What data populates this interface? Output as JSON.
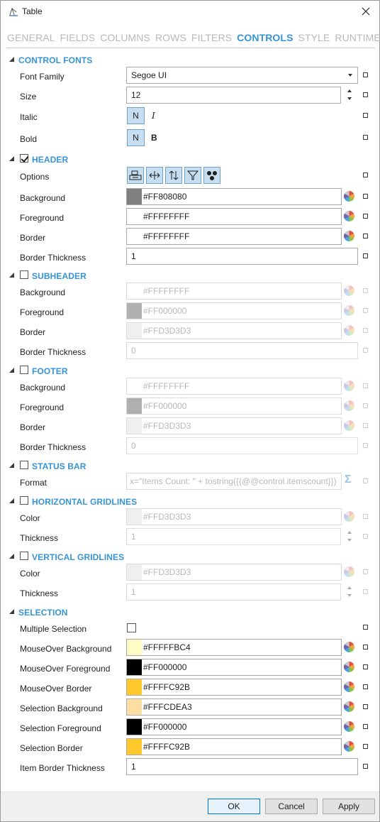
{
  "window": {
    "title": "Table"
  },
  "tabs": [
    {
      "label": "GENERAL",
      "active": false
    },
    {
      "label": "FIELDS",
      "active": false
    },
    {
      "label": "COLUMNS",
      "active": false
    },
    {
      "label": "ROWS",
      "active": false
    },
    {
      "label": "FILTERS",
      "active": false
    },
    {
      "label": "CONTROLS",
      "active": true
    },
    {
      "label": "STYLE",
      "active": false
    },
    {
      "label": "RUNTIME",
      "active": false
    }
  ],
  "control_fonts": {
    "title": "CONTROL FONTS",
    "font_family_label": "Font Family",
    "font_family_value": "Segoe UI",
    "size_label": "Size",
    "size_value": "12",
    "italic_label": "Italic",
    "italic_toggle": "N",
    "italic_glyph": "I",
    "bold_label": "Bold",
    "bold_toggle": "N",
    "bold_glyph": "B"
  },
  "header": {
    "title": "HEADER",
    "checked": true,
    "options_label": "Options",
    "option_icons": [
      "wrap-text-icon",
      "resize-horizontal-icon",
      "sort-vertical-icon",
      "filter-icon",
      "dots-icon"
    ],
    "background_label": "Background",
    "background_value": "#FF808080",
    "background_swatch": "#808080",
    "foreground_label": "Foreground",
    "foreground_value": "#FFFFFFFF",
    "foreground_swatch": "#ffffff",
    "border_label": "Border",
    "border_value": "#FFFFFFFF",
    "border_swatch": "#ffffff",
    "border_thickness_label": "Border Thickness",
    "border_thickness_value": "1"
  },
  "subheader": {
    "title": "SUBHEADER",
    "checked": false,
    "background_label": "Background",
    "background_value": "#FFFFFFFF",
    "background_swatch": "#ffffff",
    "foreground_label": "Foreground",
    "foreground_value": "#FF000000",
    "foreground_swatch": "#b0b0b0",
    "border_label": "Border",
    "border_value": "#FFD3D3D3",
    "border_swatch": "#efefef",
    "border_thickness_label": "Border Thickness",
    "border_thickness_value": "0"
  },
  "footer_section": {
    "title": "FOOTER",
    "checked": false,
    "background_label": "Background",
    "background_value": "#FFFFFFFF",
    "background_swatch": "#ffffff",
    "foreground_label": "Foreground",
    "foreground_value": "#FF000000",
    "foreground_swatch": "#b0b0b0",
    "border_label": "Border",
    "border_value": "#FFD3D3D3",
    "border_swatch": "#efefef",
    "border_thickness_label": "Border Thickness",
    "border_thickness_value": "0"
  },
  "status_bar": {
    "title": "STATUS BAR",
    "checked": false,
    "format_label": "Format",
    "format_value": "x=\"Items Count: \" + tostring({{@@control.itemscount}})"
  },
  "horizontal_gridlines": {
    "title": "HORIZONTAL GRIDLINES",
    "checked": false,
    "color_label": "Color",
    "color_value": "#FFD3D3D3",
    "color_swatch": "#efefef",
    "thickness_label": "Thickness",
    "thickness_value": "1"
  },
  "vertical_gridlines": {
    "title": "VERTICAL GRIDLINES",
    "checked": false,
    "color_label": "Color",
    "color_value": "#FFD3D3D3",
    "color_swatch": "#efefef",
    "thickness_label": "Thickness",
    "thickness_value": "1"
  },
  "selection": {
    "title": "SELECTION",
    "multiple_label": "Multiple Selection",
    "multiple_checked": false,
    "mo_bg_label": "MouseOver Background",
    "mo_bg_value": "#FFFFFBC4",
    "mo_bg_swatch": "#fffbc4",
    "mo_fg_label": "MouseOver Foreground",
    "mo_fg_value": "#FF000000",
    "mo_fg_swatch": "#000000",
    "mo_border_label": "MouseOver Border",
    "mo_border_value": "#FFFFC92B",
    "mo_border_swatch": "#ffc92b",
    "sel_bg_label": "Selection Background",
    "sel_bg_value": "#FFFCDEA3",
    "sel_bg_swatch": "#fcdea3",
    "sel_fg_label": "Selection Foreground",
    "sel_fg_value": "#FF000000",
    "sel_fg_swatch": "#000000",
    "sel_border_label": "Selection Border",
    "sel_border_value": "#FFFFC92B",
    "sel_border_swatch": "#ffc92b",
    "item_border_label": "Item Border Thickness",
    "item_border_value": "1"
  },
  "buttons": {
    "ok": "OK",
    "cancel": "Cancel",
    "apply": "Apply"
  },
  "colors": {
    "accent": "#3594d6",
    "toggle_bg": "#c7def1"
  }
}
